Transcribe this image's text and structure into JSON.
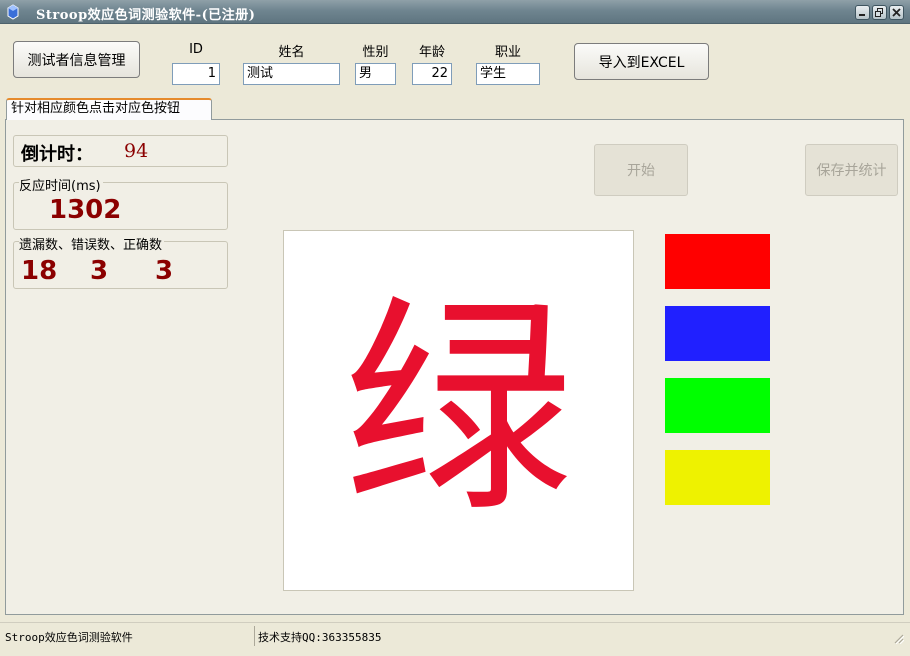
{
  "window": {
    "title": "Stroop效应色词测验软件-(已注册)",
    "icons": {
      "app": "app-icon",
      "minimize": "minimize-icon",
      "restore": "restore-icon",
      "close": "close-icon"
    }
  },
  "toolbar": {
    "manage_button": "测试者信息管理",
    "export_button": "导入到EXCEL",
    "fields": {
      "id": {
        "label": "ID",
        "value": "1"
      },
      "name": {
        "label": "姓名",
        "value": "测试"
      },
      "gender": {
        "label": "性别",
        "value": "男"
      },
      "age": {
        "label": "年龄",
        "value": "22"
      },
      "job": {
        "label": "职业",
        "value": "学生"
      }
    }
  },
  "tab": {
    "label": "针对相应颜色点击对应色按钮"
  },
  "countdown": {
    "label": "倒计时：",
    "value": "94"
  },
  "reaction": {
    "title": "反应时间(ms)",
    "value": "1302"
  },
  "counts": {
    "title": "遗漏数、错误数、正确数",
    "omitted": "18",
    "errors": "3",
    "correct": "3"
  },
  "controls": {
    "start_button": "开始",
    "save_button": "保存并统计"
  },
  "stimulus": {
    "word": "绿",
    "ink_color": "#e8102e"
  },
  "colors": [
    {
      "name": "red",
      "hex": "#ff0000"
    },
    {
      "name": "blue",
      "hex": "#2020ff"
    },
    {
      "name": "green",
      "hex": "#00ff00"
    },
    {
      "name": "yellow",
      "hex": "#eef200"
    }
  ],
  "status": {
    "left": "Stroop效应色词测验软件",
    "right": "技术支持QQ:363355835"
  }
}
